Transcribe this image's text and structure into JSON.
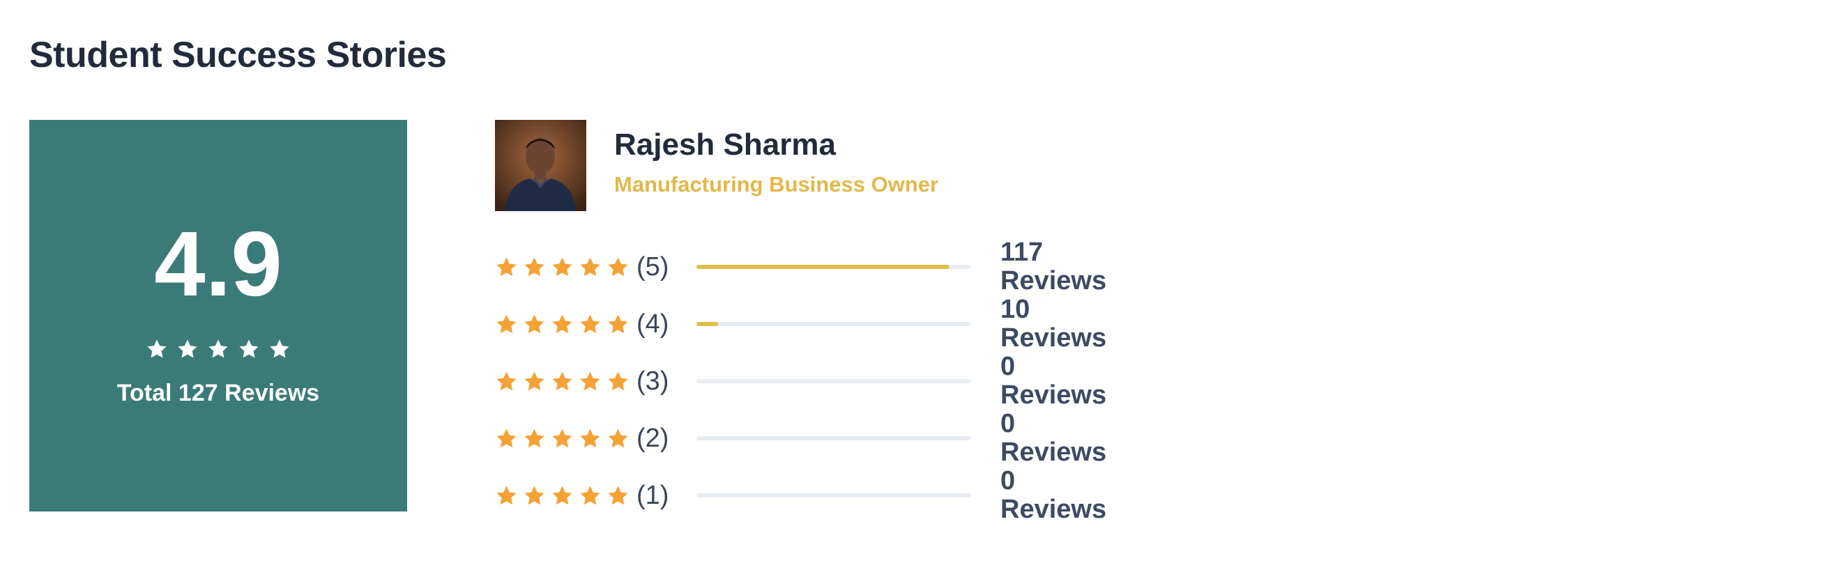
{
  "page": {
    "title": "Student Success Stories"
  },
  "summary": {
    "average": "4.9",
    "star_count": 5,
    "total_label": "Total 127 Reviews"
  },
  "profile": {
    "name": "Rajesh Sharma",
    "role": "Manufacturing Business Owner"
  },
  "breakdown": [
    {
      "level": "(5)",
      "count": "117",
      "unit": "Reviews",
      "fraction": 0.921
    },
    {
      "level": "(4)",
      "count": "10",
      "unit": "Reviews",
      "fraction": 0.079
    },
    {
      "level": "(3)",
      "count": "0",
      "unit": "Reviews",
      "fraction": 0
    },
    {
      "level": "(2)",
      "count": "0",
      "unit": "Reviews",
      "fraction": 0
    },
    {
      "level": "(1)",
      "count": "0",
      "unit": "Reviews",
      "fraction": 0
    }
  ],
  "colors": {
    "card_bg": "#3a7b78",
    "star_orange": "#f4a236",
    "bar_fill": "#e2bd4c",
    "bar_track": "#e8edf3",
    "role_text": "#e2b84a"
  },
  "icons": {
    "star": "star-icon",
    "avatar": "person-photo"
  }
}
